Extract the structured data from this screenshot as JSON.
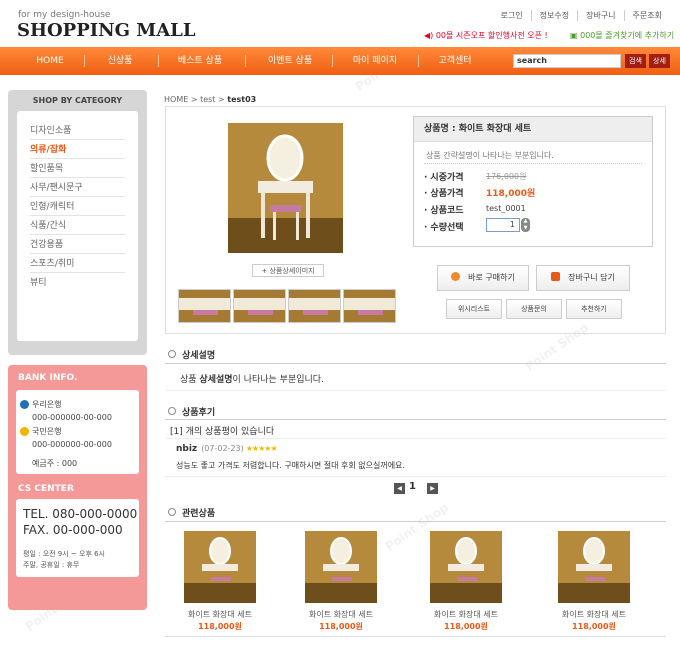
{
  "header": {
    "tagline": "for my design-house",
    "logo": "SHOPPING MALL",
    "top_links": [
      "로그인",
      "정보수정",
      "장바구니",
      "주문조회"
    ],
    "promo_left": "00몰 시즌오프 할인행사전 오픈 !",
    "promo_right": "000몰 즐겨찾기에 추가하기",
    "accent_color": "#f26a1e"
  },
  "nav": {
    "items": [
      "HOME",
      "신상품",
      "베스트 상품",
      "이벤트 상품",
      "마이 페이지",
      "고객센터"
    ],
    "search_value": "search",
    "search_btn": "검색",
    "detail_btn": "상세"
  },
  "sidebar": {
    "title": "SHOP BY CATEGORY",
    "categories": [
      "디자인소품",
      "의류/잡화",
      "할인품목",
      "사무/팬시문구",
      "인형/캐릭터",
      "식품/간식",
      "건강용품",
      "스포츠/취미",
      "뷰티"
    ],
    "active_category": "의류/잡화",
    "bank_title": "BANK INFO.",
    "banks": [
      {
        "name": "우리은행",
        "number": "000-000000-00-000"
      },
      {
        "name": "국민은행",
        "number": "000-000000-00-000"
      }
    ],
    "bank_owner": "예금주 : 000",
    "cs_title": "CS CENTER",
    "tel": "TEL. 080-000-0000",
    "fax": "FAX. 00-000-000",
    "hours_1": "평일 : 오전 9시 ~ 오후 6시",
    "hours_2": "주말, 공휴일 : 휴무"
  },
  "breadcrumb": {
    "home": "HOME",
    "cat": "test",
    "current": "test03"
  },
  "product": {
    "detail_image_btn": "+ 상품상세이미지",
    "title": "상품명 : 화이트 화장대 세트",
    "description": "상품 간략설명이 나타나는 부분입니다.",
    "rows": {
      "list_price_label": "시중가격",
      "list_price": "176,000원",
      "price_label": "상품가격",
      "price": "118,000원",
      "code_label": "상품코드",
      "code": "test_0001",
      "qty_label": "수량선택",
      "qty": "1"
    },
    "buy_now": "바로 구매하기",
    "add_cart": "장바구니 담기",
    "wishlist": "위시리스트",
    "inquiry": "상품문의",
    "recommend": "추천하기"
  },
  "detail_section": {
    "title": "상세설명",
    "text_pre": "상품 ",
    "text_bold": "상세설명",
    "text_post": "이 나타나는 부분입니다."
  },
  "review_section": {
    "title": "상품후기",
    "count_text": "[1] 개의 상품평이 있습니다",
    "reviewer": "nbiz",
    "date": "(07-02-23)",
    "stars": "★★★★★",
    "body": "성능도 좋고 가격도 저렴합니다. 구매하시면 절대 후회 없으실꺼에요.",
    "page": "1"
  },
  "related_section": {
    "title": "관련상품",
    "items": [
      {
        "name": "화이트 화장대 세트",
        "price": "118,000원"
      },
      {
        "name": "화이트 화장대 세트",
        "price": "118,000원"
      },
      {
        "name": "화이트 화장대 세트",
        "price": "118,000원"
      },
      {
        "name": "화이트 화장대 세트",
        "price": "118,000원"
      }
    ]
  }
}
